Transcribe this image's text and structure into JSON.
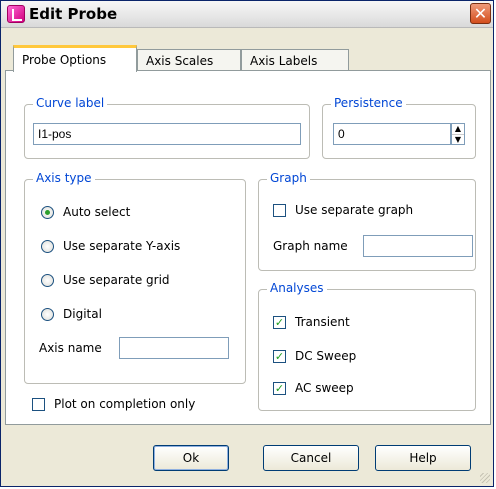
{
  "window": {
    "title": "Edit Probe"
  },
  "tabs": [
    {
      "label": "Probe Options",
      "active": true
    },
    {
      "label": "Axis Scales",
      "active": false
    },
    {
      "label": "Axis Labels",
      "active": false
    }
  ],
  "curve_label": {
    "legend": "Curve label",
    "value": "I1-pos"
  },
  "persistence": {
    "legend": "Persistence",
    "value": "0"
  },
  "axis_type": {
    "legend": "Axis type",
    "options": [
      {
        "label": "Auto select",
        "selected": true
      },
      {
        "label": "Use separate Y-axis",
        "selected": false
      },
      {
        "label": "Use separate grid",
        "selected": false
      },
      {
        "label": "Digital",
        "selected": false
      }
    ],
    "axis_name_label": "Axis name",
    "axis_name_value": ""
  },
  "graph": {
    "legend": "Graph",
    "use_separate_graph_label": "Use separate graph",
    "use_separate_graph_checked": false,
    "graph_name_label": "Graph name",
    "graph_name_value": ""
  },
  "analyses": {
    "legend": "Analyses",
    "items": [
      {
        "label": "Transient",
        "checked": true
      },
      {
        "label": "DC Sweep",
        "checked": true
      },
      {
        "label": "AC sweep",
        "checked": true
      }
    ]
  },
  "plot_on_completion": {
    "label": "Plot on completion only",
    "checked": false
  },
  "buttons": {
    "ok": "Ok",
    "cancel": "Cancel",
    "help": "Help"
  },
  "icons": {
    "close": "close-icon",
    "spin_up": "up-arrow-icon",
    "spin_down": "down-arrow-icon",
    "check": "checkmark-icon"
  },
  "colors": {
    "accent": "#0046d5",
    "tab_highlight": "#ffc83c",
    "close": "#d34e1c",
    "check": "#1e9e1e"
  }
}
